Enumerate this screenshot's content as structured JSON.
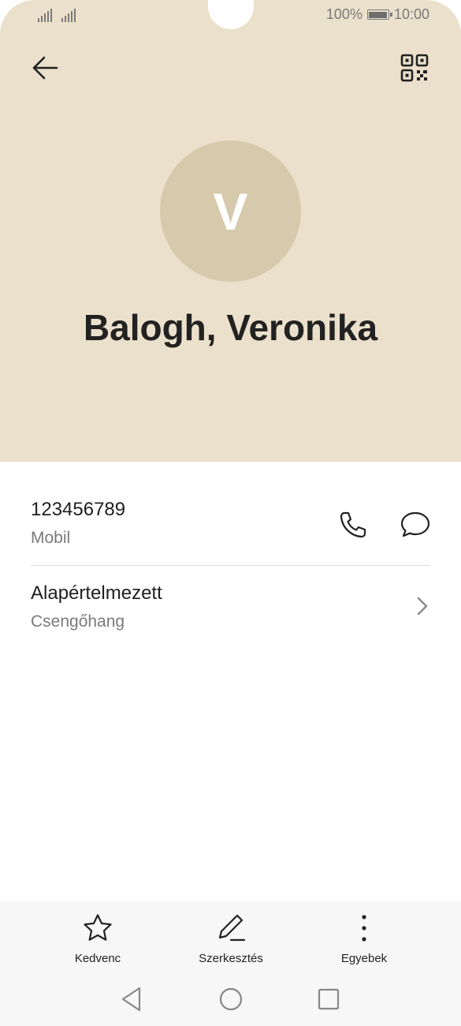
{
  "status_bar": {
    "battery": "100%",
    "time": "10:00"
  },
  "contact": {
    "initial": "V",
    "name": "Balogh, Veronika",
    "phone_number": "123456789",
    "phone_type": "Mobil",
    "ringtone_value": "Alapértelmezett",
    "ringtone_label": "Csengőhang"
  },
  "actions": {
    "favorite": "Kedvenc",
    "edit": "Szerkesztés",
    "more": "Egyebek"
  },
  "colors": {
    "header_bg": "#ebe0cb",
    "avatar_bg": "#d7c9ac"
  }
}
